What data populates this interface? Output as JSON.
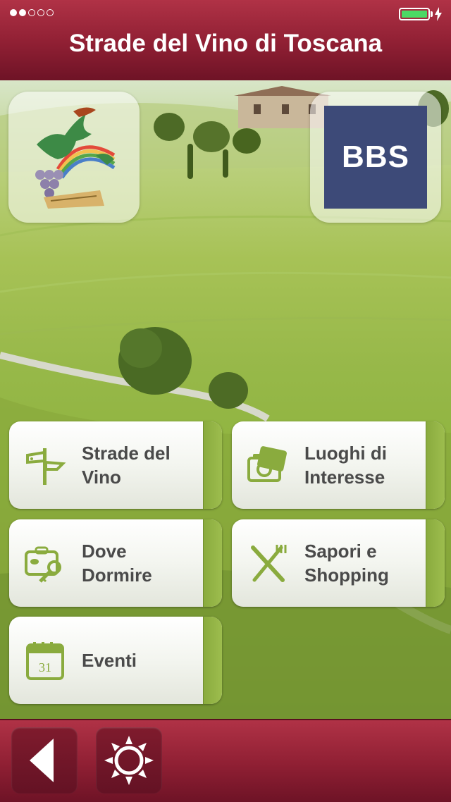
{
  "app_title": "Strade del Vino di Toscana",
  "logos": {
    "left": "regione-toscana-logo",
    "right": "BBS"
  },
  "menu": [
    {
      "line1": "Strade del",
      "line2": "Vino",
      "icon": "signpost-icon"
    },
    {
      "line1": "Luoghi di",
      "line2": "Interesse",
      "icon": "camera-icon"
    },
    {
      "line1": "Dove",
      "line2": "Dormire",
      "icon": "luggage-icon"
    },
    {
      "line1": "Sapori e",
      "line2": "Shopping",
      "icon": "fork-knife-icon"
    },
    {
      "line1": "Eventi",
      "icon": "calendar-icon",
      "calendar_day": "31"
    }
  ],
  "toolbar": {
    "back": "back-arrow-icon",
    "weather": "sun-icon"
  },
  "colors": {
    "header": "#9a2338",
    "accent_green": "#8aab3e",
    "label": "#4a4a4a"
  }
}
